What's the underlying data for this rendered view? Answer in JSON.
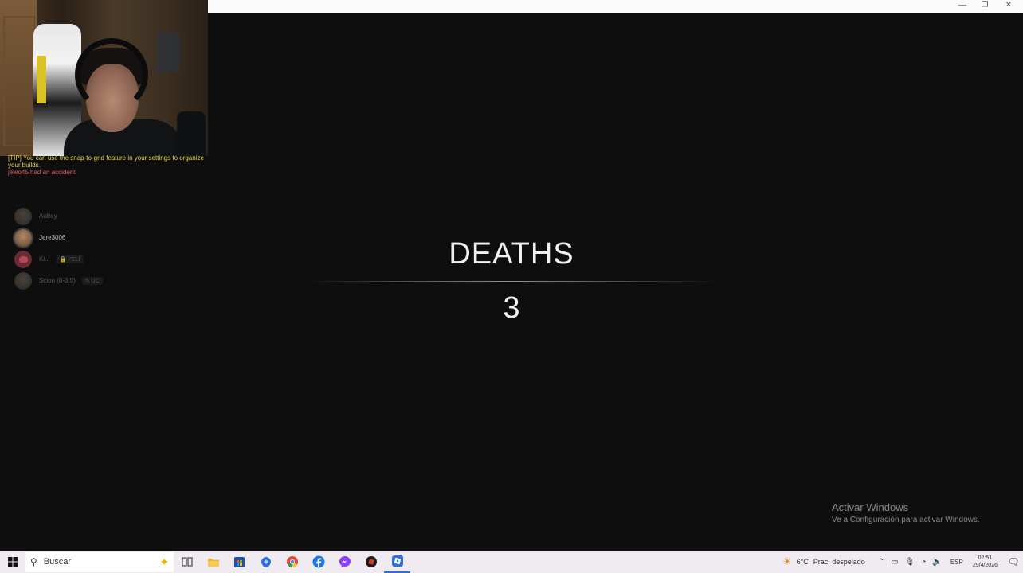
{
  "window": {
    "controls": [
      "—",
      "❐",
      "✕"
    ]
  },
  "chat": {
    "tip": "[TIP] You can use the snap-to-grid feature in your settings to organize your builds.",
    "event": "jeleo45 had an accident."
  },
  "voice_channel": {
    "members": [
      {
        "name": "Aubey",
        "tag": "",
        "state": "idle"
      },
      {
        "name": "Jere3006",
        "tag": "",
        "state": "speaking"
      },
      {
        "name": "Ki...",
        "tag": "🔒 PELI",
        "state": "idle"
      },
      {
        "name": "Scion (8-3.5)",
        "tag": "✎ UC",
        "state": "idle"
      }
    ]
  },
  "stat": {
    "title": "DEATHS",
    "value": "3"
  },
  "watermark": {
    "line1": "Activar Windows",
    "line2": "Ve a Configuración para activar Windows."
  },
  "taskbar": {
    "search_placeholder": "Buscar",
    "icons": [
      {
        "name": "task-view-icon",
        "color": "#555555"
      },
      {
        "name": "file-explorer-icon",
        "color": "#f2b533"
      },
      {
        "name": "store-icon",
        "color": "#1f4fa8"
      },
      {
        "name": "copilot-icon",
        "color": "#2f6fd6"
      },
      {
        "name": "chrome-icon",
        "color": "#e04b35"
      },
      {
        "name": "facebook-icon",
        "color": "#1877f2"
      },
      {
        "name": "messenger-icon",
        "color": "#8a3ffc"
      },
      {
        "name": "roblox-studio-icon",
        "color": "#c0392b"
      },
      {
        "name": "roblox-icon",
        "color": "#2f6fd6"
      }
    ],
    "weather": {
      "temp": "6°C",
      "desc": "Prac. despejado"
    },
    "language": "ESP",
    "time": "02:51",
    "date": "29/4/2026"
  }
}
